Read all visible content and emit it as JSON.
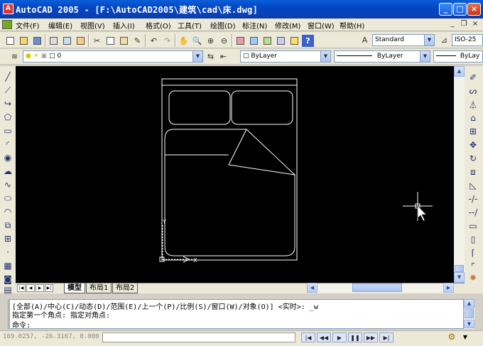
{
  "window": {
    "title": "AutoCAD 2005 - [F:\\AutoCAD2005\\建筑\\cad\\床.dwg]",
    "app_icon": "autocad-icon",
    "minimize_label": "_",
    "maximize_label": "□",
    "close_label": "×"
  },
  "menu": {
    "items": [
      "文件(F)",
      "编辑(E)",
      "视图(V)",
      "插入(I)",
      "格式(O)",
      "工具(T)",
      "绘图(D)",
      "标注(N)",
      "修改(M)",
      "窗口(W)",
      "帮助(H)"
    ],
    "mdi_minimize": "_",
    "mdi_restore": "❐",
    "mdi_close": "×"
  },
  "toolbar_standard": {
    "text_style": "Standard",
    "dim_style": "ISO-25"
  },
  "toolbar_layers": {
    "current_layer": "0",
    "color": "ByLayer",
    "linetype": "ByLayer",
    "lineweight": "ByLay"
  },
  "layout_tabs": {
    "model": "模型",
    "layout1": "布局1",
    "layout2": "布局2"
  },
  "command": {
    "line1": "[全部(A)/中心(C)/动态(D)/范围(E)/上一个(P)/比例(S)/窗口(W)/对象(O)] <实时>: _w",
    "line2": "指定第一个角点: 指定对角点:",
    "prompt": "命令:"
  },
  "status": {
    "coordinates": "169.0257, -26.3167, 0.000"
  },
  "colors": {
    "titlebar": "#0546c4",
    "canvas": "#000000",
    "drawing_lines": "#ffffff"
  }
}
